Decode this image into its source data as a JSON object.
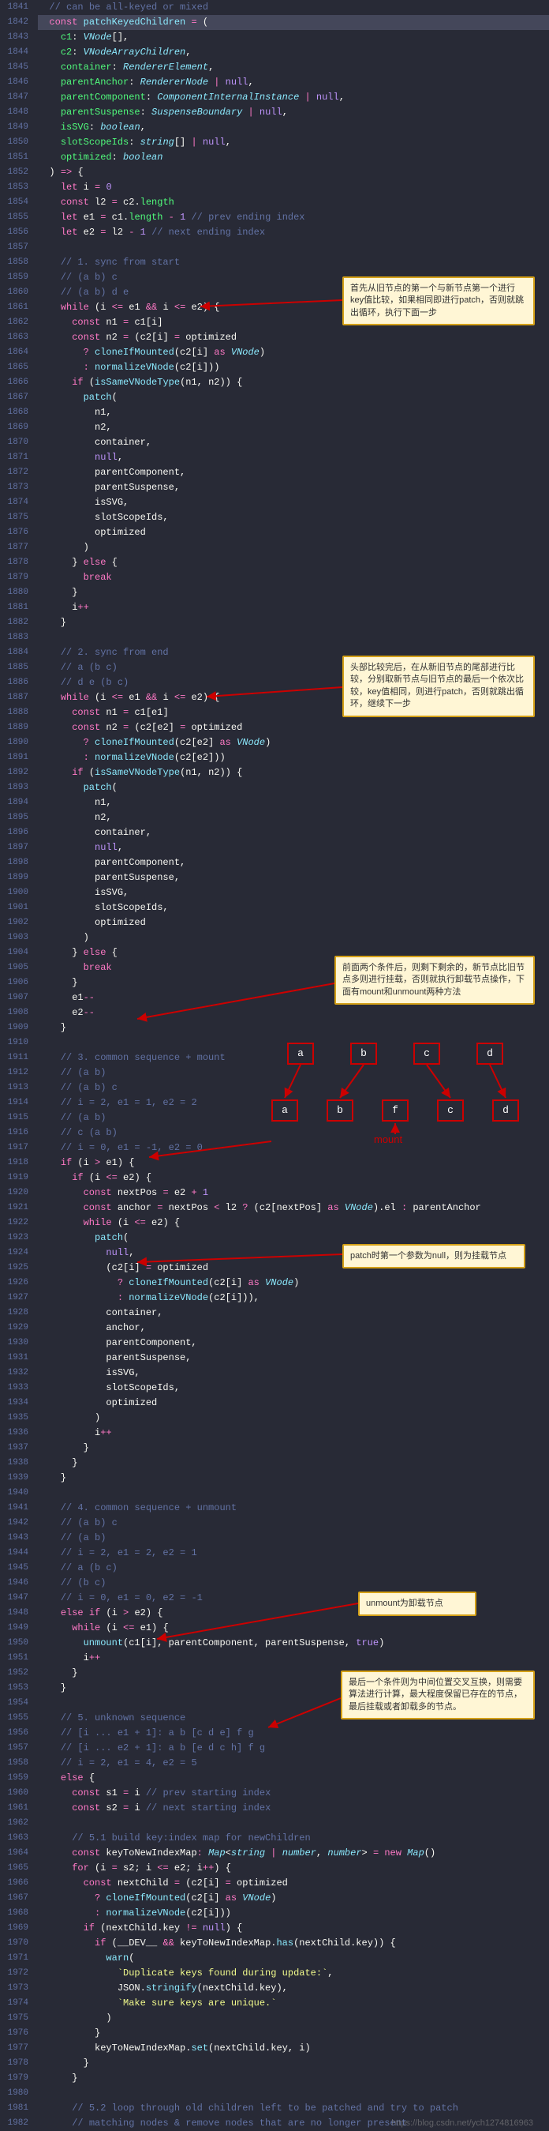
{
  "startLine": 1841,
  "endLine": 1982,
  "watermark": "https://blog.csdn.net/ych1274816963",
  "annotations": {
    "a1": "首先从旧节点的第一个与新节点第一个进行key值比较，如果相同即进行patch，否则就跳出循环，执行下面一步",
    "a2": "头部比较完后，在从新旧节点的尾部进行比较，分别取新节点与旧节点的最后一个依次比较，key值相同，则进行patch，否则就跳出循环，继续下一步",
    "a3": "前面两个条件后，则剩下剩余的，新节点比旧节点多则进行挂载，否则就执行卸载节点操作，下面有mount和unmount两种方法",
    "a4": "patch时第一个参数为null，则为挂载节点",
    "a5": "unmount为卸载节点",
    "a6": "最后一个条件则为中间位置交叉互换，则需要算法进行计算，最大程度保留已存在的节点，最后挂载或者卸载多的节点。"
  },
  "diagram": {
    "topRow": [
      "a",
      "b",
      "c",
      "d"
    ],
    "bottomRow": [
      "a",
      "b",
      "f",
      "c",
      "d"
    ],
    "mountLabel": "mount"
  },
  "code": [
    {
      "t": "// can be all-keyed or mixed",
      "cls": "c-comment",
      "indent": 2
    },
    {
      "raw": "  <span class='c-kw'>const</span> <span class='c-fn'>patchKeyedChildren</span> <span class='c-op'>=</span> (",
      "hl": true
    },
    {
      "raw": "    <span class='c-prop'>c1</span>: <span class='c-type'>VNode</span>[],"
    },
    {
      "raw": "    <span class='c-prop'>c2</span>: <span class='c-type'>VNodeArrayChildren</span>,"
    },
    {
      "raw": "    <span class='c-prop'>container</span>: <span class='c-type'>RendererElement</span>,"
    },
    {
      "raw": "    <span class='c-prop'>parentAnchor</span>: <span class='c-type'>RendererNode</span> <span class='c-op'>|</span> <span class='c-builtin'>null</span>,"
    },
    {
      "raw": "    <span class='c-prop'>parentComponent</span>: <span class='c-type'>ComponentInternalInstance</span> <span class='c-op'>|</span> <span class='c-builtin'>null</span>,"
    },
    {
      "raw": "    <span class='c-prop'>parentSuspense</span>: <span class='c-type'>SuspenseBoundary</span> <span class='c-op'>|</span> <span class='c-builtin'>null</span>,"
    },
    {
      "raw": "    <span class='c-prop'>isSVG</span>: <span class='c-type'>boolean</span>,"
    },
    {
      "raw": "    <span class='c-prop'>slotScopeIds</span>: <span class='c-type'>string</span>[] <span class='c-op'>|</span> <span class='c-builtin'>null</span>,"
    },
    {
      "raw": "    <span class='c-prop'>optimized</span>: <span class='c-type'>boolean</span>"
    },
    {
      "raw": "  ) <span class='c-op'>=&gt;</span> {"
    },
    {
      "raw": "    <span class='c-kw'>let</span> i <span class='c-op'>=</span> <span class='c-num'>0</span>"
    },
    {
      "raw": "    <span class='c-kw'>const</span> l2 <span class='c-op'>=</span> c2.<span class='c-prop'>length</span>"
    },
    {
      "raw": "    <span class='c-kw'>let</span> e1 <span class='c-op'>=</span> c1.<span class='c-prop'>length</span> <span class='c-op'>-</span> <span class='c-num'>1</span> <span class='c-comment'>// prev ending index</span>"
    },
    {
      "raw": "    <span class='c-kw'>let</span> e2 <span class='c-op'>=</span> l2 <span class='c-op'>-</span> <span class='c-num'>1</span> <span class='c-comment'>// next ending index</span>"
    },
    {
      "raw": ""
    },
    {
      "t": "// 1. sync from start",
      "cls": "c-comment",
      "indent": 4
    },
    {
      "t": "// (a b) c",
      "cls": "c-comment",
      "indent": 4
    },
    {
      "t": "// (a b) d e",
      "cls": "c-comment",
      "indent": 4
    },
    {
      "raw": "    <span class='c-kw'>while</span> (i <span class='c-op'>&lt;=</span> e1 <span class='c-op'>&amp;&amp;</span> i <span class='c-op'>&lt;=</span> e2) {"
    },
    {
      "raw": "      <span class='c-kw'>const</span> n1 <span class='c-op'>=</span> c1[i]"
    },
    {
      "raw": "      <span class='c-kw'>const</span> n2 <span class='c-op'>=</span> (c2[i] <span class='c-op'>=</span> optimized"
    },
    {
      "raw": "        <span class='c-op'>?</span> <span class='c-fn'>cloneIfMounted</span>(c2[i] <span class='c-kw'>as</span> <span class='c-type'>VNode</span>)"
    },
    {
      "raw": "        <span class='c-op'>:</span> <span class='c-fn'>normalizeVNode</span>(c2[i]))"
    },
    {
      "raw": "      <span class='c-kw'>if</span> (<span class='c-fn'>isSameVNodeType</span>(n1, n2)) {"
    },
    {
      "raw": "        <span class='c-fn'>patch</span>("
    },
    {
      "raw": "          n1,"
    },
    {
      "raw": "          n2,"
    },
    {
      "raw": "          container,"
    },
    {
      "raw": "          <span class='c-builtin'>null</span>,"
    },
    {
      "raw": "          parentComponent,"
    },
    {
      "raw": "          parentSuspense,"
    },
    {
      "raw": "          isSVG,"
    },
    {
      "raw": "          slotScopeIds,"
    },
    {
      "raw": "          optimized"
    },
    {
      "raw": "        )"
    },
    {
      "raw": "      } <span class='c-kw'>else</span> {"
    },
    {
      "raw": "        <span class='c-kw'>break</span>"
    },
    {
      "raw": "      }"
    },
    {
      "raw": "      i<span class='c-op'>++</span>"
    },
    {
      "raw": "    }"
    },
    {
      "raw": ""
    },
    {
      "t": "// 2. sync from end",
      "cls": "c-comment",
      "indent": 4
    },
    {
      "t": "// a (b c)",
      "cls": "c-comment",
      "indent": 4
    },
    {
      "t": "// d e (b c)",
      "cls": "c-comment",
      "indent": 4
    },
    {
      "raw": "    <span class='c-kw'>while</span> (i <span class='c-op'>&lt;=</span> e1 <span class='c-op'>&amp;&amp;</span> i <span class='c-op'>&lt;=</span> e2) {"
    },
    {
      "raw": "      <span class='c-kw'>const</span> n1 <span class='c-op'>=</span> c1[e1]"
    },
    {
      "raw": "      <span class='c-kw'>const</span> n2 <span class='c-op'>=</span> (c2[e2] <span class='c-op'>=</span> optimized"
    },
    {
      "raw": "        <span class='c-op'>?</span> <span class='c-fn'>cloneIfMounted</span>(c2[e2] <span class='c-kw'>as</span> <span class='c-type'>VNode</span>)"
    },
    {
      "raw": "        <span class='c-op'>:</span> <span class='c-fn'>normalizeVNode</span>(c2[e2]))"
    },
    {
      "raw": "      <span class='c-kw'>if</span> (<span class='c-fn'>isSameVNodeType</span>(n1, n2)) {"
    },
    {
      "raw": "        <span class='c-fn'>patch</span>("
    },
    {
      "raw": "          n1,"
    },
    {
      "raw": "          n2,"
    },
    {
      "raw": "          container,"
    },
    {
      "raw": "          <span class='c-builtin'>null</span>,"
    },
    {
      "raw": "          parentComponent,"
    },
    {
      "raw": "          parentSuspense,"
    },
    {
      "raw": "          isSVG,"
    },
    {
      "raw": "          slotScopeIds,"
    },
    {
      "raw": "          optimized"
    },
    {
      "raw": "        )"
    },
    {
      "raw": "      } <span class='c-kw'>else</span> {"
    },
    {
      "raw": "        <span class='c-kw'>break</span>"
    },
    {
      "raw": "      }"
    },
    {
      "raw": "      e1<span class='c-op'>--</span>"
    },
    {
      "raw": "      e2<span class='c-op'>--</span>"
    },
    {
      "raw": "    }"
    },
    {
      "raw": ""
    },
    {
      "t": "// 3. common sequence + mount",
      "cls": "c-comment",
      "indent": 4
    },
    {
      "t": "// (a b)",
      "cls": "c-comment",
      "indent": 4
    },
    {
      "t": "// (a b) c",
      "cls": "c-comment",
      "indent": 4
    },
    {
      "t": "// i = 2, e1 = 1, e2 = 2",
      "cls": "c-comment",
      "indent": 4
    },
    {
      "t": "// (a b)",
      "cls": "c-comment",
      "indent": 4
    },
    {
      "t": "// c (a b)",
      "cls": "c-comment",
      "indent": 4
    },
    {
      "t": "// i = 0, e1 = -1, e2 = 0",
      "cls": "c-comment",
      "indent": 4
    },
    {
      "raw": "    <span class='c-kw'>if</span> (i <span class='c-op'>&gt;</span> e1) {"
    },
    {
      "raw": "      <span class='c-kw'>if</span> (i <span class='c-op'>&lt;=</span> e2) {"
    },
    {
      "raw": "        <span class='c-kw'>const</span> nextPos <span class='c-op'>=</span> e2 <span class='c-op'>+</span> <span class='c-num'>1</span>"
    },
    {
      "raw": "        <span class='c-kw'>const</span> anchor <span class='c-op'>=</span> nextPos <span class='c-op'>&lt;</span> l2 <span class='c-op'>?</span> (c2[nextPos] <span class='c-kw'>as</span> <span class='c-type'>VNode</span>).el <span class='c-op'>:</span> parentAnchor"
    },
    {
      "raw": "        <span class='c-kw'>while</span> (i <span class='c-op'>&lt;=</span> e2) {"
    },
    {
      "raw": "          <span class='c-fn'>patch</span>("
    },
    {
      "raw": "            <span class='c-builtin'>null</span>,"
    },
    {
      "raw": "            (c2[i] <span class='c-op'>=</span> optimized"
    },
    {
      "raw": "              <span class='c-op'>?</span> <span class='c-fn'>cloneIfMounted</span>(c2[i] <span class='c-kw'>as</span> <span class='c-type'>VNode</span>)"
    },
    {
      "raw": "              <span class='c-op'>:</span> <span class='c-fn'>normalizeVNode</span>(c2[i])),"
    },
    {
      "raw": "            container,"
    },
    {
      "raw": "            anchor,"
    },
    {
      "raw": "            parentComponent,"
    },
    {
      "raw": "            parentSuspense,"
    },
    {
      "raw": "            isSVG,"
    },
    {
      "raw": "            slotScopeIds,"
    },
    {
      "raw": "            optimized"
    },
    {
      "raw": "          )"
    },
    {
      "raw": "          i<span class='c-op'>++</span>"
    },
    {
      "raw": "        }"
    },
    {
      "raw": "      }"
    },
    {
      "raw": "    }"
    },
    {
      "raw": ""
    },
    {
      "t": "// 4. common sequence + unmount",
      "cls": "c-comment",
      "indent": 4
    },
    {
      "t": "// (a b) c",
      "cls": "c-comment",
      "indent": 4
    },
    {
      "t": "// (a b)",
      "cls": "c-comment",
      "indent": 4
    },
    {
      "t": "// i = 2, e1 = 2, e2 = 1",
      "cls": "c-comment",
      "indent": 4
    },
    {
      "t": "// a (b c)",
      "cls": "c-comment",
      "indent": 4
    },
    {
      "t": "// (b c)",
      "cls": "c-comment",
      "indent": 4
    },
    {
      "t": "// i = 0, e1 = 0, e2 = -1",
      "cls": "c-comment",
      "indent": 4
    },
    {
      "raw": "    <span class='c-kw'>else</span> <span class='c-kw'>if</span> (i <span class='c-op'>&gt;</span> e2) {"
    },
    {
      "raw": "      <span class='c-kw'>while</span> (i <span class='c-op'>&lt;=</span> e1) {"
    },
    {
      "raw": "        <span class='c-fn'>unmount</span>(c1[i], parentComponent, parentSuspense, <span class='c-builtin'>true</span>)"
    },
    {
      "raw": "        i<span class='c-op'>++</span>"
    },
    {
      "raw": "      }"
    },
    {
      "raw": "    }"
    },
    {
      "raw": ""
    },
    {
      "t": "// 5. unknown sequence",
      "cls": "c-comment",
      "indent": 4
    },
    {
      "t": "// [i ... e1 + 1]: a b [c d e] f g",
      "cls": "c-comment",
      "indent": 4
    },
    {
      "t": "// [i ... e2 + 1]: a b [e d c h] f g",
      "cls": "c-comment",
      "indent": 4
    },
    {
      "t": "// i = 2, e1 = 4, e2 = 5",
      "cls": "c-comment",
      "indent": 4
    },
    {
      "raw": "    <span class='c-kw'>else</span> {"
    },
    {
      "raw": "      <span class='c-kw'>const</span> s1 <span class='c-op'>=</span> i <span class='c-comment'>// prev starting index</span>"
    },
    {
      "raw": "      <span class='c-kw'>const</span> s2 <span class='c-op'>=</span> i <span class='c-comment'>// next starting index</span>"
    },
    {
      "raw": ""
    },
    {
      "t": "// 5.1 build key:index map for newChildren",
      "cls": "c-comment",
      "indent": 6
    },
    {
      "raw": "      <span class='c-kw'>const</span> keyToNewIndexMap<span class='c-op'>:</span> <span class='c-type'>Map</span>&lt;<span class='c-type'>string</span> <span class='c-op'>|</span> <span class='c-type'>number</span>, <span class='c-type'>number</span>&gt; <span class='c-op'>=</span> <span class='c-kw'>new</span> <span class='c-type'>Map</span>()"
    },
    {
      "raw": "      <span class='c-kw'>for</span> (i <span class='c-op'>=</span> s2; i <span class='c-op'>&lt;=</span> e2; i<span class='c-op'>++</span>) {"
    },
    {
      "raw": "        <span class='c-kw'>const</span> nextChild <span class='c-op'>=</span> (c2[i] <span class='c-op'>=</span> optimized"
    },
    {
      "raw": "          <span class='c-op'>?</span> <span class='c-fn'>cloneIfMounted</span>(c2[i] <span class='c-kw'>as</span> <span class='c-type'>VNode</span>)"
    },
    {
      "raw": "          <span class='c-op'>:</span> <span class='c-fn'>normalizeVNode</span>(c2[i]))"
    },
    {
      "raw": "        <span class='c-kw'>if</span> (nextChild.key <span class='c-op'>!=</span> <span class='c-builtin'>null</span>) {"
    },
    {
      "raw": "          <span class='c-kw'>if</span> (__DEV__ <span class='c-op'>&amp;&amp;</span> keyToNewIndexMap.<span class='c-fn'>has</span>(nextChild.key)) {"
    },
    {
      "raw": "            <span class='c-fn'>warn</span>("
    },
    {
      "raw": "              <span class='c-str'>`Duplicate keys found during update:`</span>,"
    },
    {
      "raw": "              JSON.<span class='c-fn'>stringify</span>(nextChild.key),"
    },
    {
      "raw": "              <span class='c-str'>`Make sure keys are unique.`</span>"
    },
    {
      "raw": "            )"
    },
    {
      "raw": "          }"
    },
    {
      "raw": "          keyToNewIndexMap.<span class='c-fn'>set</span>(nextChild.key, i)"
    },
    {
      "raw": "        }"
    },
    {
      "raw": "      }"
    },
    {
      "raw": ""
    },
    {
      "t": "// 5.2 loop through old children left to be patched and try to patch",
      "cls": "c-comment",
      "indent": 6
    },
    {
      "t": "// matching nodes & remove nodes that are no longer present",
      "cls": "c-comment",
      "indent": 6
    }
  ]
}
